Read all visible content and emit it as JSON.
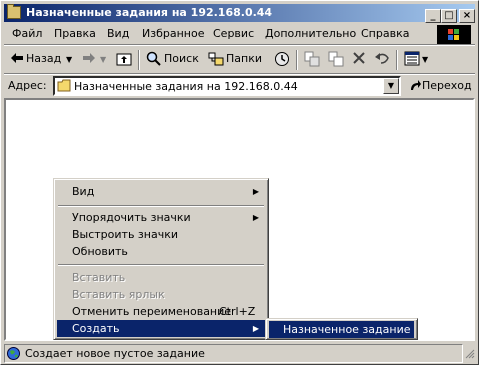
{
  "window": {
    "title": "Назначенные задания на 192.168.0.44"
  },
  "titlebar_buttons": {
    "minimize": "_",
    "maximize": "□",
    "close": "×"
  },
  "menubar": {
    "items": [
      "Файл",
      "Правка",
      "Вид",
      "Избранное",
      "Сервис",
      "Дополнительно",
      "Справка"
    ]
  },
  "toolbar": {
    "back_label": "Назад",
    "search_label": "Поиск",
    "folders_label": "Папки",
    "icons": [
      "back-arrow-icon",
      "forward-arrow-icon",
      "up-folder-icon",
      "search-icon",
      "folders-icon",
      "history-icon",
      "move-to-icon",
      "copy-to-icon",
      "delete-icon",
      "undo-icon",
      "views-icon"
    ]
  },
  "address": {
    "label": "Адрес:",
    "value": "Назначенные задания на 192.168.0.44",
    "go_label": "Переход"
  },
  "context_menu": {
    "items": [
      {
        "label": "Вид",
        "submenu": true,
        "disabled": false
      },
      {
        "label": "Упорядочить значки",
        "submenu": true,
        "disabled": false
      },
      {
        "label": "Выстроить значки",
        "submenu": false,
        "disabled": false
      },
      {
        "label": "Обновить",
        "submenu": false,
        "disabled": false
      },
      {
        "label": "Вставить",
        "submenu": false,
        "disabled": true
      },
      {
        "label": "Вставить ярлык",
        "submenu": false,
        "disabled": true
      },
      {
        "label": "Отменить переименование",
        "shortcut": "Ctrl+Z",
        "submenu": false,
        "disabled": false
      },
      {
        "label": "Создать",
        "submenu": true,
        "disabled": false,
        "highlighted": true
      }
    ]
  },
  "submenu": {
    "items": [
      {
        "label": "Назначенное задание",
        "highlighted": true
      }
    ]
  },
  "statusbar": {
    "text": "Создает новое пустое задание"
  },
  "colors": {
    "titlebar": "#0a246a",
    "highlight": "#0a246a",
    "face": "#d4d0c8"
  }
}
